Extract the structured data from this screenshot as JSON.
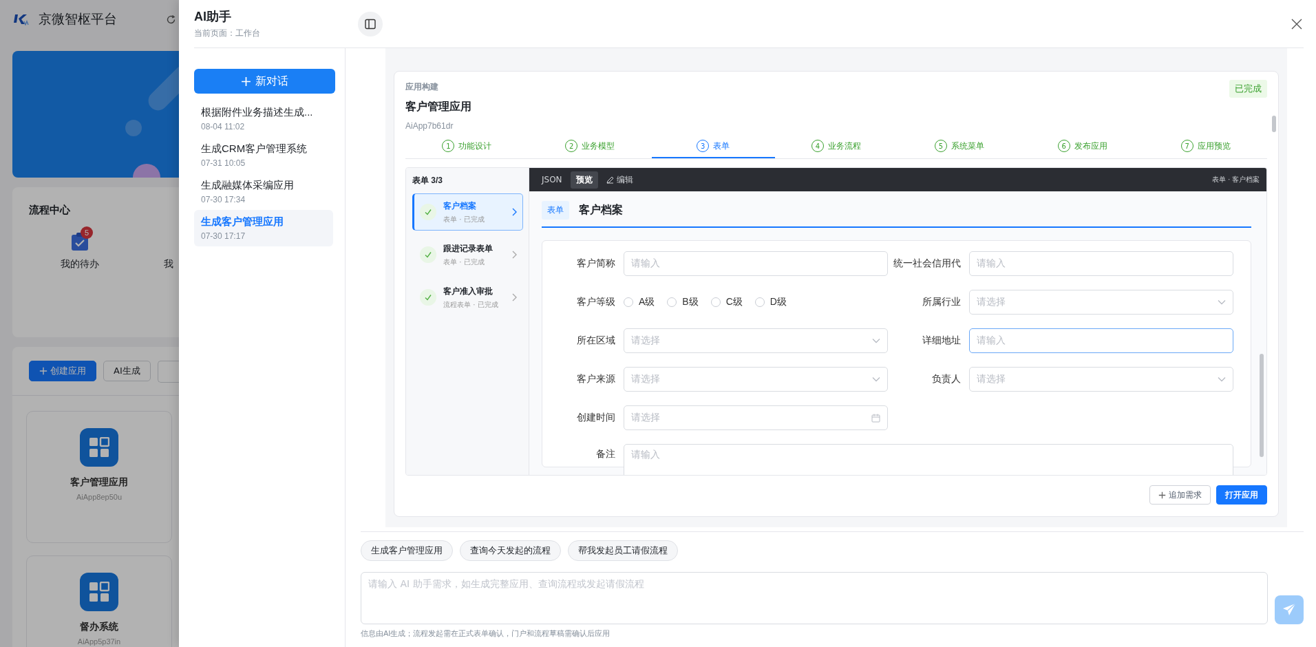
{
  "background_page": {
    "brand": "京微智枢平台",
    "process_center": {
      "title": "流程中心",
      "items": [
        {
          "label": "我的待办",
          "badge": "5"
        },
        {
          "label": "我"
        }
      ]
    },
    "toolbar": [
      {
        "label": "创建应用",
        "kind": "primary"
      },
      {
        "label": "AI生成",
        "kind": "default"
      }
    ],
    "apps": [
      {
        "name": "客户管理应用",
        "code": "AiApp8ep50u"
      },
      {
        "name": "督办系统",
        "code": "AiApp5p37in"
      }
    ]
  },
  "drawer": {
    "title": "AI助手",
    "subtitle": "当前页面：工作台"
  },
  "sidebar": {
    "new_chat": "新对话",
    "items": [
      {
        "title": "根据附件业务描述生成...",
        "time": "08-04 11:02",
        "selected": false
      },
      {
        "title": "生成CRM客户管理系统",
        "time": "07-31 10:05",
        "selected": false
      },
      {
        "title": "生成融媒体采编应用",
        "time": "07-30 17:34",
        "selected": false
      },
      {
        "title": "生成客户管理应用",
        "time": "07-30 17:17",
        "selected": true
      }
    ]
  },
  "app_card": {
    "label": "应用构建",
    "title": "客户管理应用",
    "code": "AiApp7b61dr",
    "status": "已完成",
    "steps": [
      {
        "number": "1",
        "label": "功能设计",
        "selected": false
      },
      {
        "number": "2",
        "label": "业务模型",
        "selected": false
      },
      {
        "number": "3",
        "label": "表单",
        "selected": true
      },
      {
        "number": "4",
        "label": "业务流程",
        "selected": false
      },
      {
        "number": "5",
        "label": "系统菜单",
        "selected": false
      },
      {
        "number": "6",
        "label": "发布应用",
        "selected": false
      },
      {
        "number": "7",
        "label": "应用预览",
        "selected": false
      }
    ],
    "forms": {
      "header": "表单 3/3",
      "items": [
        {
          "title": "客户档案",
          "meta": "表单 · 已完成",
          "selected": true
        },
        {
          "title": "跟进记录表单",
          "meta": "表单 · 已完成",
          "selected": false
        },
        {
          "title": "客户准入审批",
          "meta": "流程表单 · 已完成",
          "selected": false
        }
      ]
    },
    "preview": {
      "tabs": [
        {
          "label": "JSON",
          "kind": "text",
          "selected": false
        },
        {
          "label": "预览",
          "kind": "text",
          "selected": true
        },
        {
          "label": "编辑",
          "kind": "edit",
          "selected": false
        }
      ],
      "breadcrumb": "表单 · 客户档案",
      "tag": "表单",
      "title": "客户档案",
      "fields": [
        {
          "label": "客户简称",
          "kind": "input",
          "placeholder": "请输入",
          "focused": false
        },
        {
          "label": "统一社会信用代",
          "kind": "input",
          "placeholder": "请输入",
          "focused": false
        },
        {
          "label": "客户等级",
          "kind": "radio",
          "options": [
            {
              "label": "A级",
              "checked": false
            },
            {
              "label": "B级",
              "checked": false
            },
            {
              "label": "C级",
              "checked": false
            },
            {
              "label": "D级",
              "checked": false
            }
          ]
        },
        {
          "label": "所属行业",
          "kind": "select",
          "placeholder": "请选择",
          "focused": false
        },
        {
          "label": "所在区域",
          "kind": "select",
          "placeholder": "请选择",
          "focused": false
        },
        {
          "label": "详细地址",
          "kind": "input",
          "placeholder": "请输入",
          "focused": true
        },
        {
          "label": "客户来源",
          "kind": "select",
          "placeholder": "请选择",
          "focused": false
        },
        {
          "label": "负责人",
          "kind": "select",
          "placeholder": "请选择",
          "focused": false
        },
        {
          "label": "创建时间",
          "kind": "date",
          "placeholder": "请选择",
          "focused": false
        },
        {
          "label": "备注",
          "kind": "textarea",
          "placeholder": "请输入",
          "focused": false
        }
      ]
    },
    "actions": [
      {
        "label": "追加需求",
        "kind": "add"
      },
      {
        "label": "打开应用",
        "kind": "primary"
      }
    ]
  },
  "suggestions": [
    "生成客户管理应用",
    "查询今天发起的流程",
    "帮我发起员工请假流程"
  ],
  "input": {
    "placeholder": "请输入 AI 助手需求，如生成完整应用、查询流程或发起请假流程"
  },
  "note": "信息由AI生成；流程发起需在正式表单确认，门户和流程草稿需确认后应用"
}
